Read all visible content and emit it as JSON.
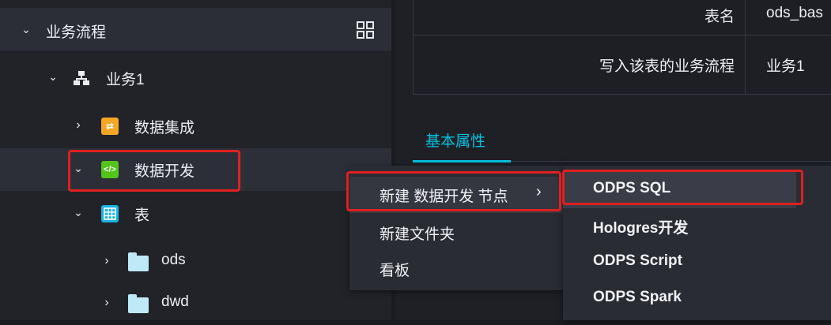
{
  "sidebar": {
    "header": {
      "label": "业务流程"
    },
    "tree": {
      "business": "业务1",
      "integration": "数据集成",
      "development": "数据开发",
      "table": "表",
      "ods": "ods",
      "dwd": "dwd"
    }
  },
  "detail": {
    "rows": [
      {
        "key": "表名",
        "value": "ods_bas"
      },
      {
        "key": "写入该表的业务流程",
        "value": "业务1"
      }
    ],
    "tab": "基本属性"
  },
  "context_menu": {
    "items": [
      "新建 数据开发 节点",
      "新建文件夹",
      "看板"
    ]
  },
  "submenu": {
    "items": [
      "ODPS SQL",
      "Hologres开发",
      "ODPS Script",
      "ODPS Spark"
    ]
  },
  "icons": {
    "layout": "grid-icon",
    "business": "flow-icon",
    "integration": "arrows-swap-icon",
    "development": "code-icon",
    "table": "table-icon",
    "folder": "folder-icon"
  },
  "colors": {
    "accent": "#00c1de",
    "highlight_box": "#e02020",
    "integration_icon": "#f5a623",
    "development_icon": "#52c41a",
    "table_icon": "#1ab3e6"
  }
}
